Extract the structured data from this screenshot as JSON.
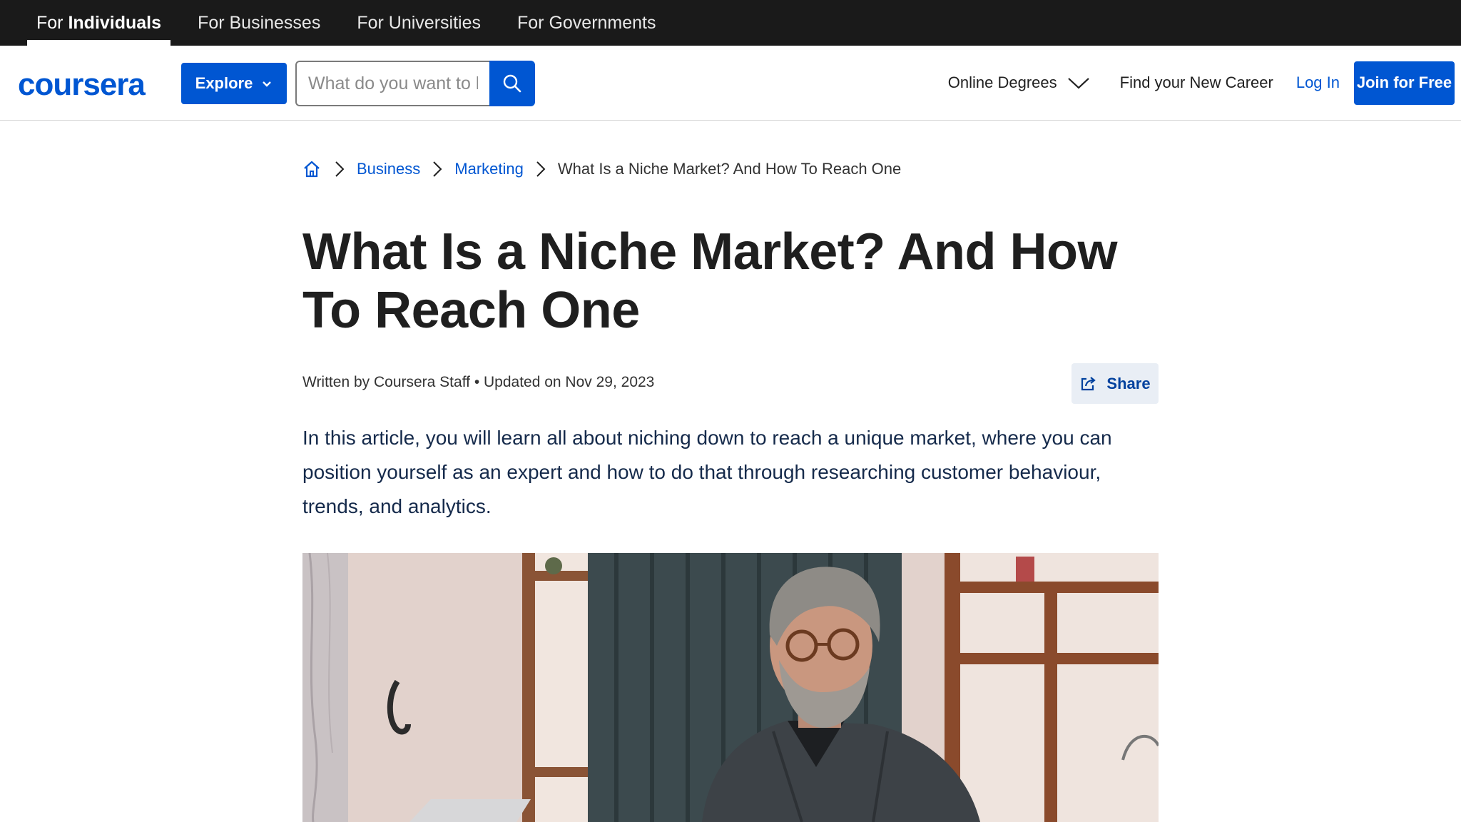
{
  "topbar": {
    "tabs": [
      {
        "prefix": "For ",
        "label": "Individuals"
      },
      {
        "label": "For Businesses"
      },
      {
        "label": "For Universities"
      },
      {
        "label": "For Governments"
      }
    ]
  },
  "header": {
    "logo": "coursera",
    "explore_label": "Explore",
    "search_placeholder": "What do you want to learn?",
    "nav": {
      "degrees": "Online Degrees",
      "career": "Find your New Career",
      "login": "Log In",
      "join": "Join for Free"
    }
  },
  "breadcrumb": {
    "items": [
      "Business",
      "Marketing"
    ],
    "current": "What Is a Niche Market? And How To Reach One"
  },
  "article": {
    "title": "What Is a Niche Market? And How To Reach One",
    "meta": "Written by Coursera Staff • Updated on Nov 29, 2023",
    "share_label": "Share",
    "intro": "In this article, you will learn all about niching down to reach a unique market, where you can position yourself as an expert and how to do that through researching customer behaviour, trends, and analytics."
  },
  "colors": {
    "brand": "#0056d2",
    "topbar": "#1a1a1a"
  }
}
